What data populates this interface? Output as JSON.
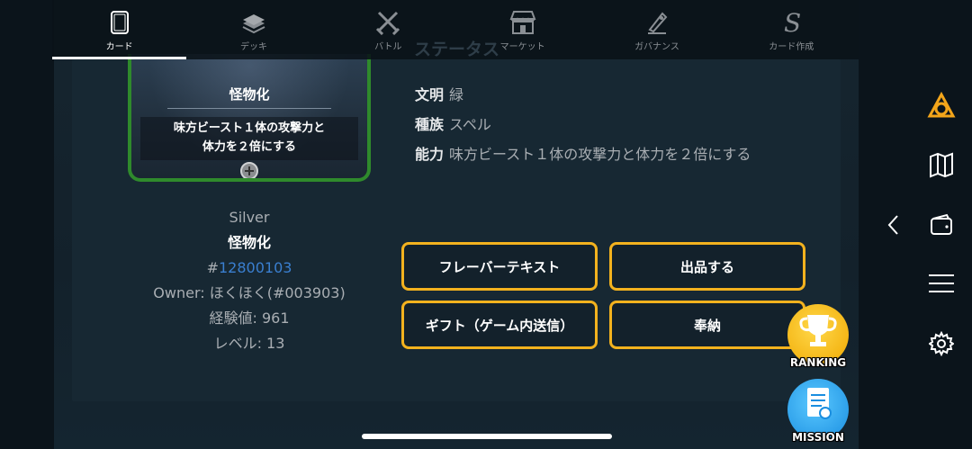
{
  "nav": {
    "items": [
      {
        "label": "カード",
        "icon": "card-icon",
        "active": true
      },
      {
        "label": "デッキ",
        "icon": "deck-icon",
        "active": false
      },
      {
        "label": "バトル",
        "icon": "swords-icon",
        "active": false
      },
      {
        "label": "マーケット",
        "icon": "shop-icon",
        "active": false
      },
      {
        "label": "ガバナンス",
        "icon": "quill-icon",
        "active": false
      },
      {
        "label": "カード作成",
        "icon": "s-script-icon",
        "active": false
      }
    ]
  },
  "card": {
    "name": "怪物化",
    "description_line1": "味方ビースト１体の攻撃力と",
    "description_line2": "体力を２倍にする"
  },
  "info": {
    "rarity": "Silver",
    "name": "怪物化",
    "id_prefix": "#",
    "id": "12800103",
    "owner": "Owner: ほくほく(#003903)",
    "exp": "経験値: 961",
    "level": "レベル: 13"
  },
  "status": {
    "title": "ステータス",
    "civilization_label": "文明",
    "civilization_value": "緑",
    "race_label": "種族",
    "race_value": "スペル",
    "ability_label": "能力",
    "ability_value": "味方ビースト１体の攻撃力と体力を２倍にする"
  },
  "buttons": {
    "flavor_text": "フレーバーテキスト",
    "list_for_sale": "出品する",
    "gift": "ギフト（ゲーム内送信）",
    "dedicate": "奉納"
  },
  "badges": {
    "ranking": "RANKING",
    "mission": "MISSION"
  },
  "sidebar": {
    "icons": [
      "logo-icon",
      "map-icon",
      "wallet-icon",
      "menu-icon",
      "settings-icon"
    ]
  },
  "colors": {
    "accent": "#f3b21e",
    "link": "#3a7fd0",
    "card_border": "#2f8a2c"
  }
}
